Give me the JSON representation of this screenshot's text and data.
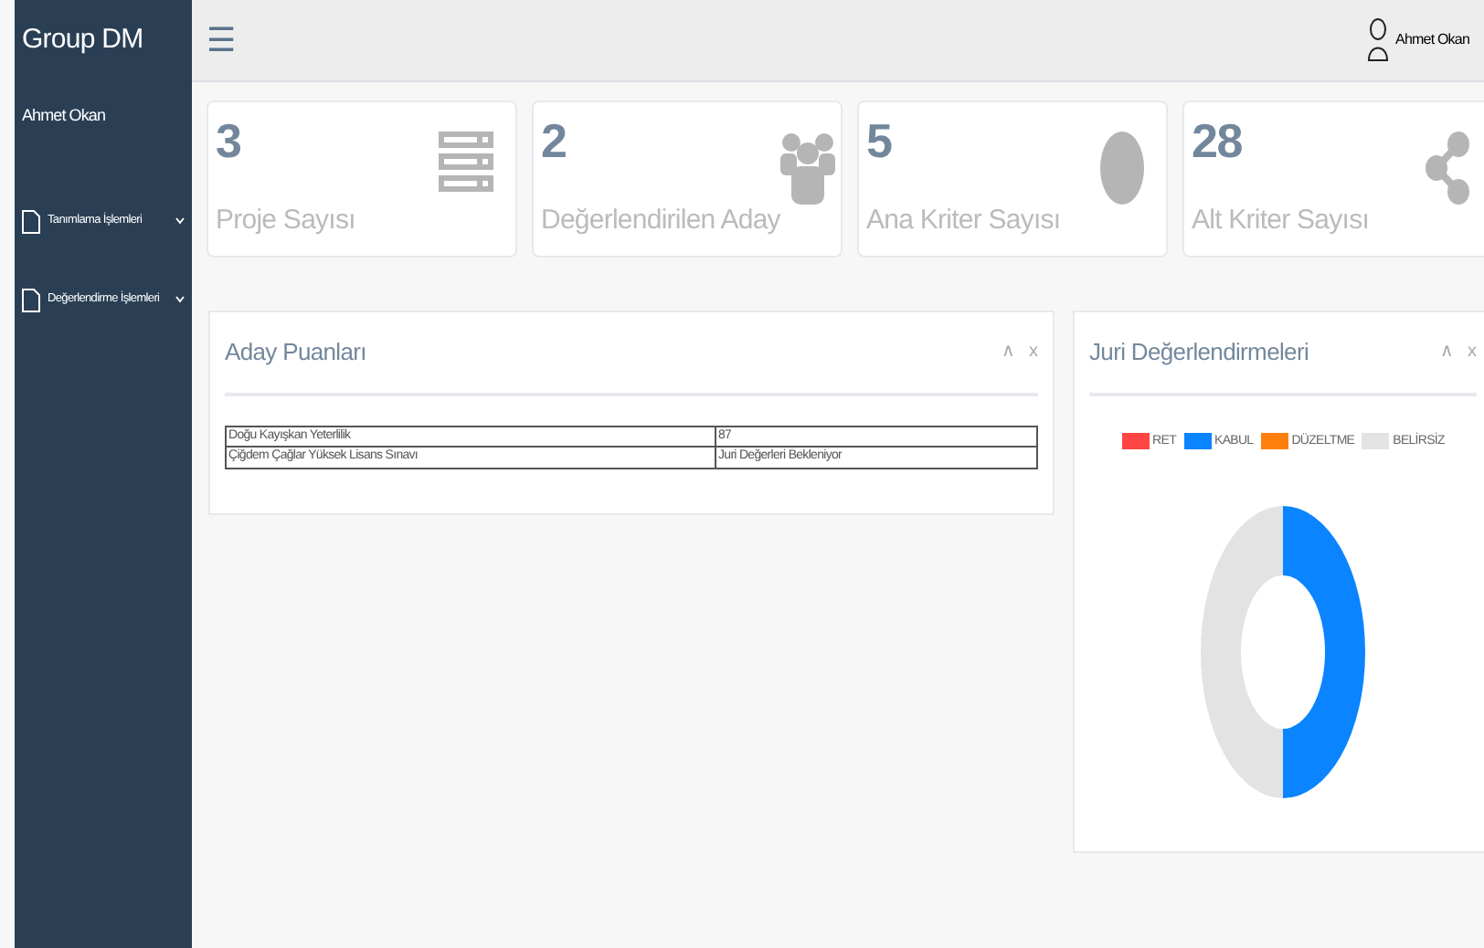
{
  "sidebar": {
    "brand": "Group DM",
    "user": "Ahmet Okan",
    "items": [
      {
        "label": "Tanımlama İşlemleri",
        "expanded": false
      },
      {
        "label": "Değerlendirme İşlemleri",
        "expanded": false
      }
    ]
  },
  "topbar": {
    "menu_glyph": "☰",
    "user": "Ahmet Okan"
  },
  "stats": [
    {
      "value": "3",
      "label": "Proje Sayısı",
      "kind": "server"
    },
    {
      "value": "2",
      "label": "Değerlendirilen Aday",
      "kind": "users"
    },
    {
      "value": "5",
      "label": "Ana Kriter Sayısı",
      "kind": "circle"
    },
    {
      "value": "28",
      "label": "Alt Kriter Sayısı",
      "kind": "share"
    }
  ],
  "candidate_panel": {
    "title": "Aday Puanları",
    "controls": [
      "∧",
      "x"
    ],
    "rows": [
      [
        "Doğu Kayışkan Yeterlilik",
        "87"
      ],
      [
        "Çiğdem Çağlar Yüksek Lisans Sınavı",
        "Juri Değerleri Bekleniyor"
      ]
    ]
  },
  "jury_panel": {
    "title": "Juri Değerlendirmeleri",
    "controls": [
      "∧",
      "x"
    ],
    "legend": [
      {
        "label": "RET",
        "color": "#ff4444"
      },
      {
        "label": "KABUL",
        "color": "#0a84ff"
      },
      {
        "label": "DÜZELTME",
        "color": "#ff7f0e"
      },
      {
        "label": "BELİRSİZ",
        "color": "#e3e3e3"
      }
    ]
  }
}
